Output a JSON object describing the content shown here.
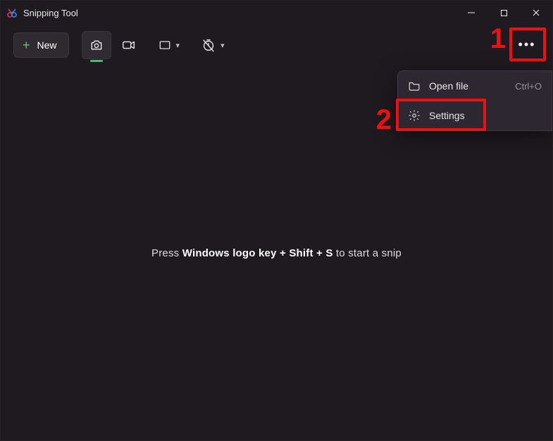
{
  "title": "Snipping Tool",
  "toolbar": {
    "new_label": "New"
  },
  "hint": {
    "prefix": "Press ",
    "keys": "Windows logo key + Shift + S",
    "suffix": " to start a snip"
  },
  "menu": {
    "open_file_label": "Open file",
    "open_file_shortcut": "Ctrl+O",
    "settings_label": "Settings"
  },
  "annotations": {
    "one": "1",
    "two": "2"
  }
}
